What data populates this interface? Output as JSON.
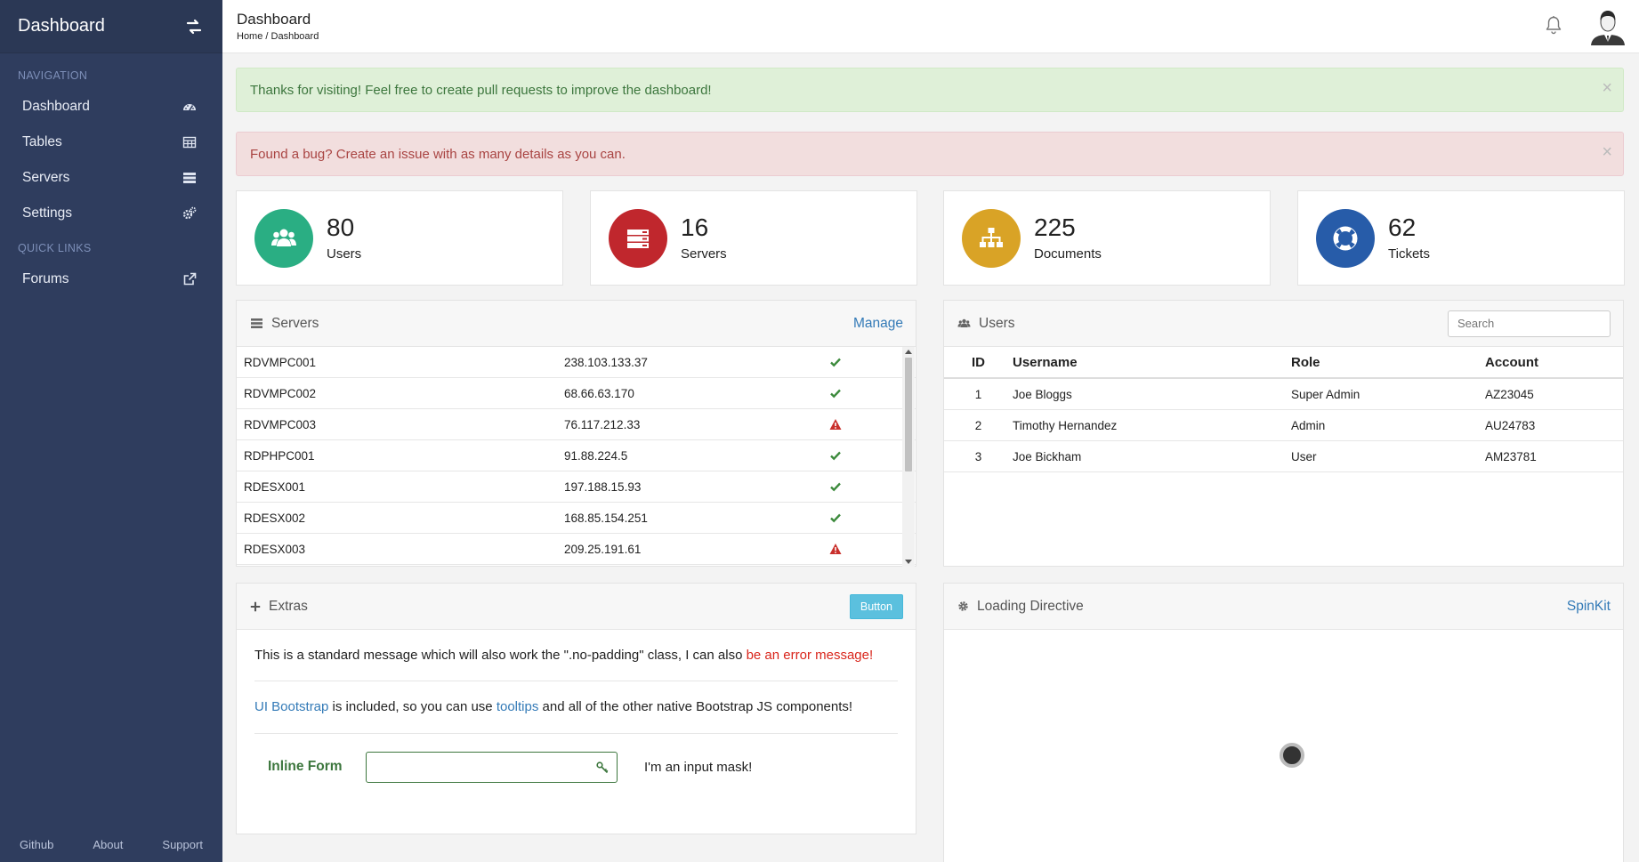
{
  "sidebar": {
    "brand": "Dashboard",
    "nav_title": "NAVIGATION",
    "nav_items": [
      {
        "label": "Dashboard",
        "icon": "tachometer-icon"
      },
      {
        "label": "Tables",
        "icon": "table-icon"
      },
      {
        "label": "Servers",
        "icon": "server-list-icon"
      },
      {
        "label": "Settings",
        "icon": "cogs-icon"
      }
    ],
    "quick_title": "QUICK LINKS",
    "quick_items": [
      {
        "label": "Forums",
        "icon": "external-link-icon"
      }
    ],
    "footer": [
      "Github",
      "About",
      "Support"
    ]
  },
  "header": {
    "title": "Dashboard",
    "breadcrumb": "Home / Dashboard"
  },
  "alerts": {
    "success": "Thanks for visiting! Feel free to create pull requests to improve the dashboard!",
    "danger": "Found a bug? Create an issue with as many details as you can.",
    "close": "×"
  },
  "tiles": [
    {
      "value": "80",
      "label": "Users",
      "color": "#2aae83",
      "icon": "users-icon"
    },
    {
      "value": "16",
      "label": "Servers",
      "color": "#c0272d",
      "icon": "server-icon"
    },
    {
      "value": "225",
      "label": "Documents",
      "color": "#d9a326",
      "icon": "sitemap-icon"
    },
    {
      "value": "62",
      "label": "Tickets",
      "color": "#275ca9",
      "icon": "lifebuoy-icon"
    }
  ],
  "servers_panel": {
    "title": "Servers",
    "manage": "Manage",
    "rows": [
      {
        "name": "RDVMPC001",
        "ip": "238.103.133.37",
        "status": "ok"
      },
      {
        "name": "RDVMPC002",
        "ip": "68.66.63.170",
        "status": "ok"
      },
      {
        "name": "RDVMPC003",
        "ip": "76.117.212.33",
        "status": "warning"
      },
      {
        "name": "RDPHPC001",
        "ip": "91.88.224.5",
        "status": "ok"
      },
      {
        "name": "RDESX001",
        "ip": "197.188.15.93",
        "status": "ok"
      },
      {
        "name": "RDESX002",
        "ip": "168.85.154.251",
        "status": "ok"
      },
      {
        "name": "RDESX003",
        "ip": "209.25.191.61",
        "status": "warning"
      }
    ]
  },
  "users_panel": {
    "title": "Users",
    "search_placeholder": "Search",
    "columns": [
      "ID",
      "Username",
      "Role",
      "Account"
    ],
    "rows": [
      [
        "1",
        "Joe Bloggs",
        "Super Admin",
        "AZ23045"
      ],
      [
        "2",
        "Timothy Hernandez",
        "Admin",
        "AU24783"
      ],
      [
        "3",
        "Joe Bickham",
        "User",
        "AM23781"
      ]
    ]
  },
  "extras_panel": {
    "title": "Extras",
    "button": "Button",
    "msg1_text": "This is a standard message which will also work the \".no-padding\" class, I can also ",
    "msg1_error": "be an error message!",
    "msg2_link1": "UI Bootstrap",
    "msg2_text1": " is included, so you can use ",
    "msg2_link2": "tooltips",
    "msg2_text2": " and all of the other native Bootstrap JS components!",
    "form_label": "Inline Form",
    "mask_text": "I'm an input mask!"
  },
  "loading_panel": {
    "title": "Loading Directive",
    "link": "SpinKit"
  },
  "colors": {
    "sidebar": "#2f3d5e",
    "ok": "#3c8a3c",
    "warning": "#c9302c",
    "link": "#337ab7"
  }
}
